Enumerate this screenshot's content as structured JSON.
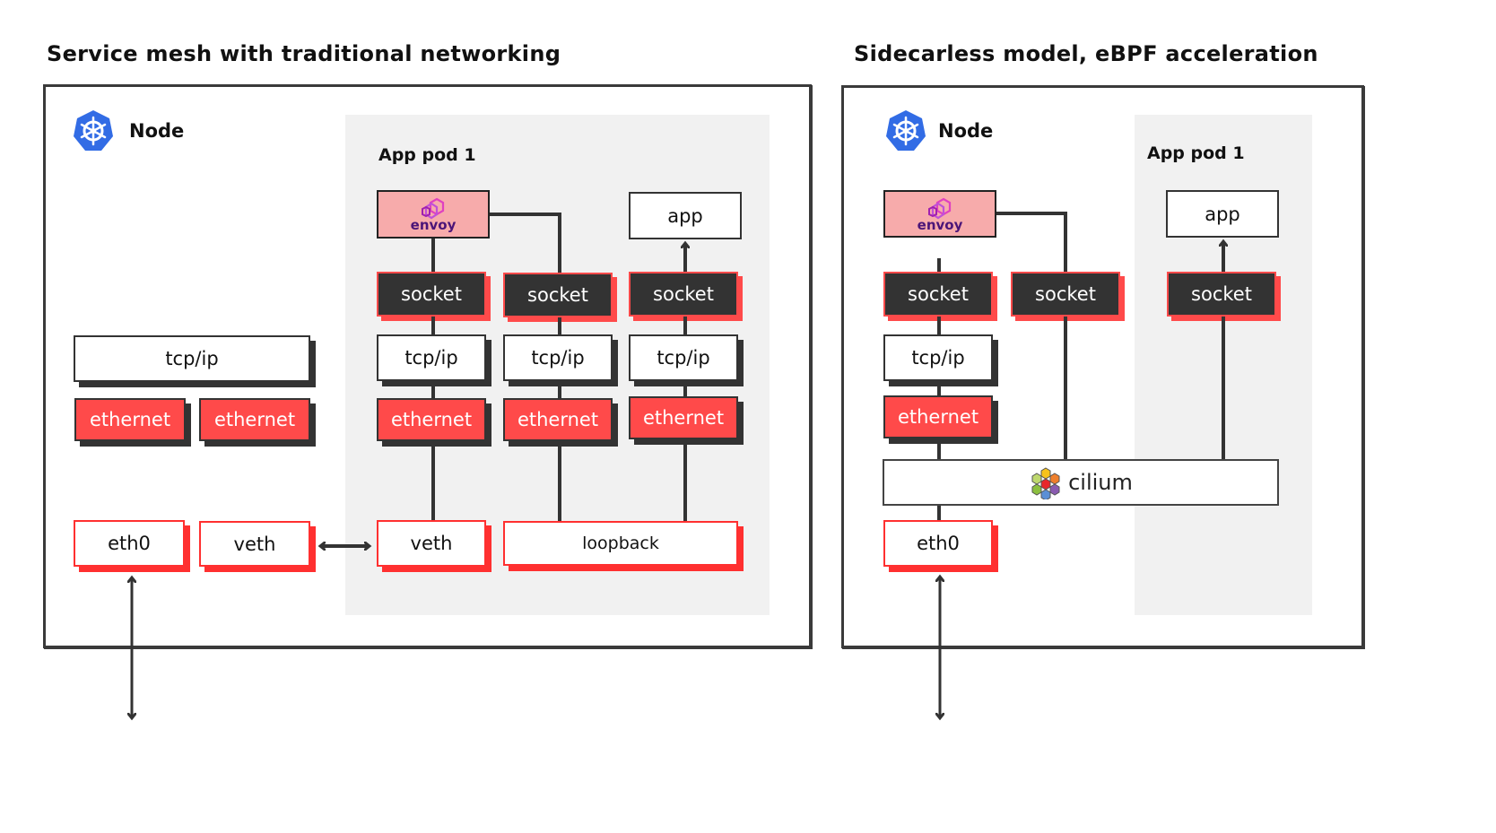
{
  "left_panel": {
    "title": "Service mesh with traditional networking",
    "node_label": "Node",
    "node_icon": "kubernetes-helm-icon",
    "pod_label": "App pod 1",
    "host_stack": {
      "tcpip": "tcp/ip",
      "ethernet": [
        "ethernet",
        "ethernet"
      ],
      "interfaces": [
        "eth0",
        "veth"
      ]
    },
    "pod_stack": {
      "envoy": "envoy",
      "app": "app",
      "columns": [
        {
          "socket": "socket",
          "tcpip": "tcp/ip",
          "ethernet": "ethernet"
        },
        {
          "socket": "socket",
          "tcpip": "tcp/ip",
          "ethernet": "ethernet"
        },
        {
          "socket": "socket",
          "tcpip": "tcp/ip",
          "ethernet": "ethernet"
        }
      ],
      "veth": "veth",
      "loopback": "loopback"
    }
  },
  "right_panel": {
    "title": "Sidecarless model, eBPF acceleration",
    "node_label": "Node",
    "node_icon": "kubernetes-helm-icon",
    "pod_label": "App pod 1",
    "envoy": "envoy",
    "app": "app",
    "sockets": [
      "socket",
      "socket",
      "socket"
    ],
    "tcpip": "tcp/ip",
    "ethernet": "ethernet",
    "cilium": "cilium",
    "eth0": "eth0"
  },
  "colors": {
    "accent_red": "#ff4a4a",
    "dark": "#333333",
    "envoy_pink": "#f7abab",
    "pod_bg": "#f1f1f1",
    "kubernetes_blue": "#326ce5"
  }
}
